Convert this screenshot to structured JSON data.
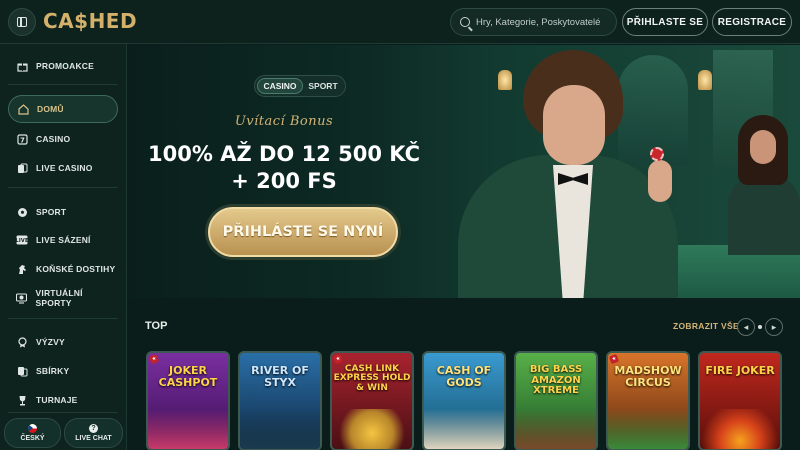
{
  "header": {
    "logo": "CA$HED",
    "search_placeholder": "Hry, Kategorie, Poskytovatelé",
    "login_label": "PŘIHLASTE SE",
    "register_label": "REGISTRACE"
  },
  "sidebar": {
    "items": [
      {
        "label": "PROMOAKCE",
        "icon": "gift-icon"
      },
      {
        "label": "DOMŮ",
        "icon": "home-icon"
      },
      {
        "label": "CASINO",
        "icon": "casino-icon"
      },
      {
        "label": "LIVE CASINO",
        "icon": "live-casino-icon"
      },
      {
        "label": "SPORT",
        "icon": "soccer-ball-icon"
      },
      {
        "label": "LIVE SÁZENÍ",
        "icon": "live-badge-icon"
      },
      {
        "label": "KOŇSKÉ DOSTIHY",
        "icon": "horse-icon"
      },
      {
        "label": "VIRTUÁLNÍ SPORTY",
        "icon": "virtual-sports-icon"
      },
      {
        "label": "VÝZVY",
        "icon": "medal-icon"
      },
      {
        "label": "SBÍRKY",
        "icon": "collection-icon"
      },
      {
        "label": "TURNAJE",
        "icon": "trophy-icon"
      }
    ],
    "active_item": "DOMŮ",
    "language_label": "ČESKÝ",
    "chat_label": "LIVE CHAT"
  },
  "hero": {
    "tabs": [
      "CASINO",
      "SPORT"
    ],
    "active_tab": "CASINO",
    "bonus_label": "Uvítací Bonus",
    "line1": "100% AŽ DO 12 500 KČ",
    "line2": "+ 200 FS",
    "cta_label": "PŘIHLÁSTE SE NYNÍ"
  },
  "top_section": {
    "title": "TOP",
    "show_all_label": "ZOBRAZIT VŠE",
    "games": [
      {
        "title": "JOKER CASHPOT",
        "color": "#5a1f7a"
      },
      {
        "title": "RIVER OF STYX",
        "color": "#1f4f7a"
      },
      {
        "title": "CASH LINK EXPRESS HOLD & WIN",
        "color": "#7a1f2a"
      },
      {
        "title": "CASH OF GODS",
        "color": "#1f6a8a"
      },
      {
        "title": "BIG BASS AMAZON XTREME",
        "color": "#2f7a3a"
      },
      {
        "title": "MADSHOW CIRCUS",
        "color": "#6a3a1a"
      },
      {
        "title": "FIRE JOKER",
        "color": "#8a1f1a"
      }
    ]
  },
  "colors": {
    "accent_gold": "#d3b477",
    "background": "#0b1d1a"
  }
}
